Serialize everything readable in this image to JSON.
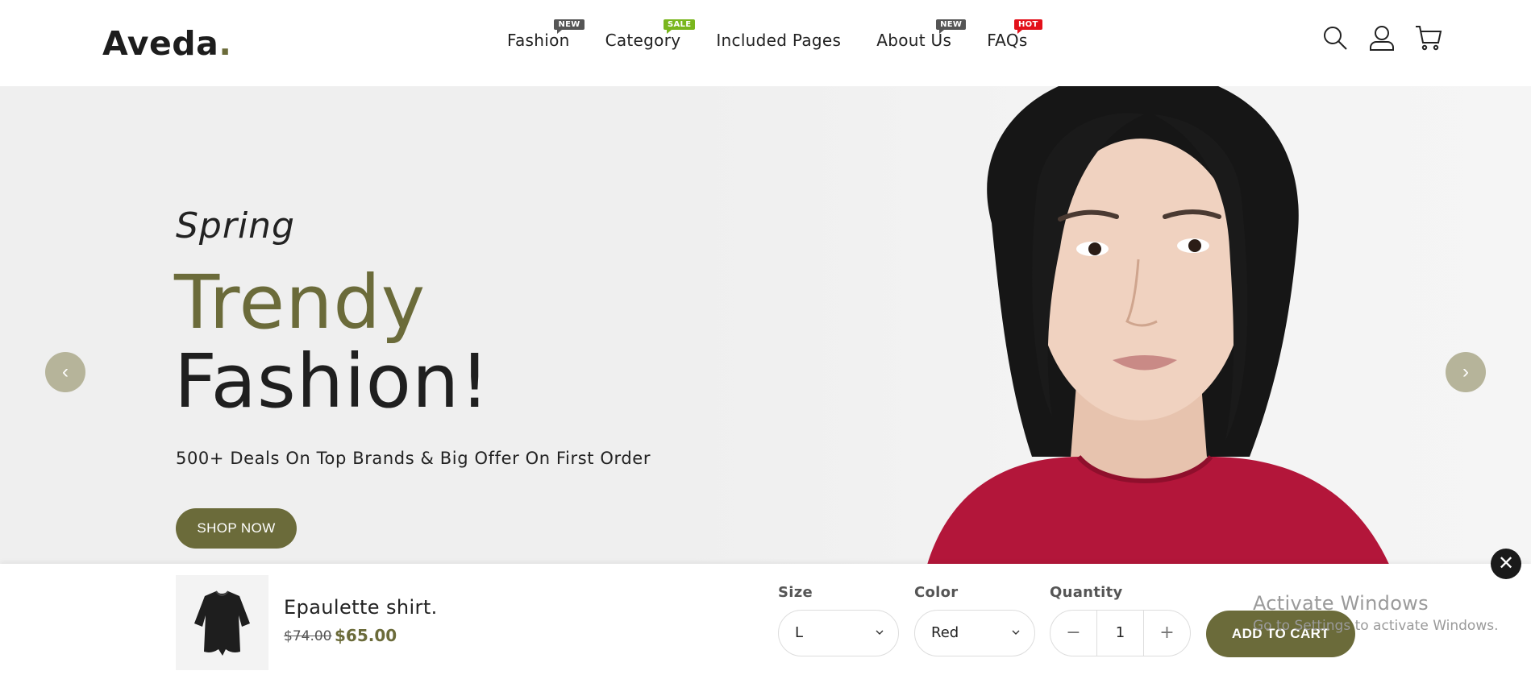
{
  "brand": {
    "name": "Aveda",
    "dot": "."
  },
  "nav": [
    {
      "label": "Fashion",
      "badge": "NEW",
      "badge_type": "new"
    },
    {
      "label": "Category",
      "badge": "SALE",
      "badge_type": "sale"
    },
    {
      "label": "Included Pages",
      "badge": "",
      "badge_type": ""
    },
    {
      "label": "About Us",
      "badge": "NEW",
      "badge_type": "new"
    },
    {
      "label": "FAQs",
      "badge": "HOT",
      "badge_type": "hot"
    }
  ],
  "header_icons": [
    "search-icon",
    "user-icon",
    "cart-icon"
  ],
  "hero": {
    "subtitle": "Spring",
    "title_line1": "Trendy",
    "title_line2": "Fashion!",
    "description": "500+ Deals On Top Brands & Big Offer On First Order",
    "cta": "SHOP NOW",
    "prev_symbol": "‹",
    "next_symbol": "›"
  },
  "sticky_cart": {
    "product_name": "Epaulette shirt.",
    "old_price": "$74.00",
    "new_price": "$65.00",
    "size_label": "Size",
    "size_value": "L",
    "color_label": "Color",
    "color_value": "Red",
    "quantity_label": "Quantity",
    "quantity_value": "1",
    "minus_symbol": "−",
    "plus_symbol": "+",
    "add_to_cart": "ADD TO CART",
    "close_symbol": "✕"
  },
  "watermark": {
    "title": "Activate Windows",
    "subtitle": "Go to Settings to activate Windows."
  },
  "colors": {
    "accent": "#6b6b3a",
    "badge_new": "#555555",
    "badge_sale": "#79b61d",
    "badge_hot": "#e3101a",
    "hero_bg": "#efefef",
    "shirt": "#b3163a"
  }
}
